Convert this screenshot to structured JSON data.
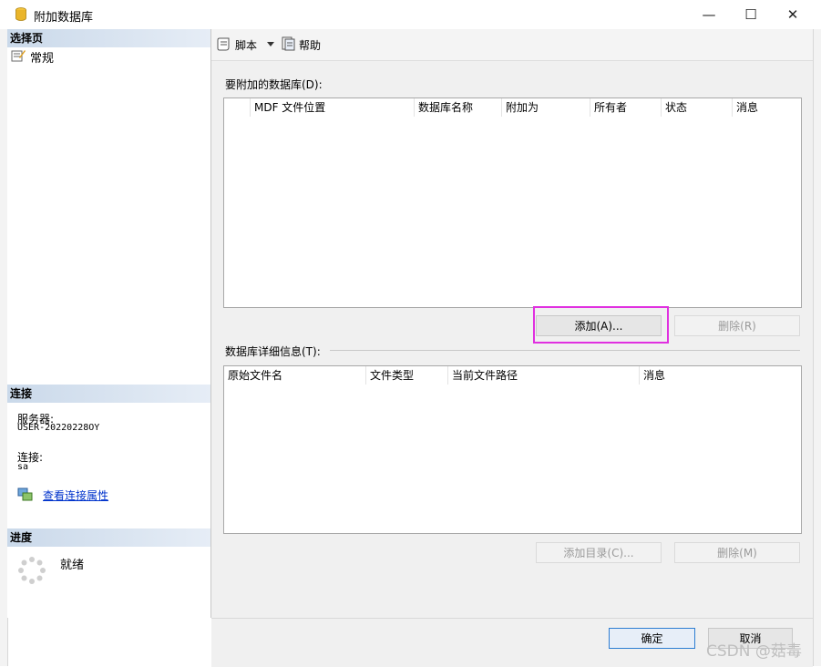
{
  "window": {
    "title": "附加数据库",
    "minimize_glyph": "—",
    "maximize_glyph": "☐",
    "close_glyph": "✕"
  },
  "left": {
    "select_page_header": "选择页",
    "pages": [
      {
        "label": "常规",
        "icon": "general-page-icon"
      }
    ],
    "connection_header": "连接",
    "server_label": "服务器:",
    "server_value": "USER-20220228OY",
    "connection_label": "连接:",
    "connection_value": "sa",
    "view_connection_link": "查看连接属性",
    "progress_header": "进度",
    "progress_status": "就绪"
  },
  "toolbar": {
    "script_label": "脚本",
    "help_label": "帮助"
  },
  "attach": {
    "section_label": "要附加的数据库(D):",
    "columns": [
      "MDF 文件位置",
      "数据库名称",
      "附加为",
      "所有者",
      "状态",
      "消息"
    ],
    "add_button": "添加(A)...",
    "remove_button": "删除(R)"
  },
  "details": {
    "section_label": "数据库详细信息(T):",
    "columns": [
      "原始文件名",
      "文件类型",
      "当前文件路径",
      "消息"
    ],
    "add_catalog_button": "添加目录(C)...",
    "remove_button": "删除(M)"
  },
  "footer": {
    "ok_button": "确定",
    "cancel_button": "取消"
  },
  "watermark": "CSDN @菇毒",
  "colors": {
    "highlight": "#e030e0",
    "link": "#0033cc",
    "header_gradient": "#cad9ea"
  }
}
